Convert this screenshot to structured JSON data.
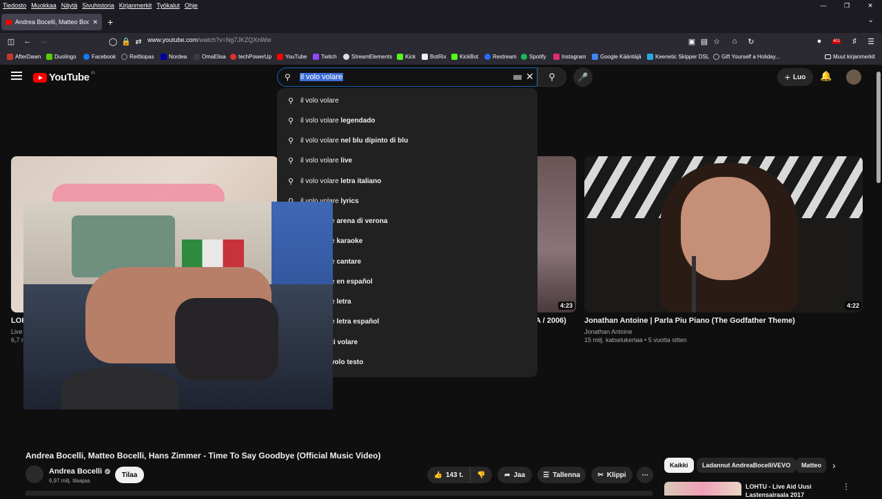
{
  "menu": [
    "Tiedosto",
    "Muokkaa",
    "Näytä",
    "Sivuhistoria",
    "Kirjanmerkit",
    "Työkalut",
    "Ohje"
  ],
  "tab": {
    "title": "Andrea Bocelli, Matteo Bocelli, H"
  },
  "address": {
    "host": "www.youtube.com",
    "path": "/watch?v=Ng7JKZQXnWw"
  },
  "extension_badge": "401",
  "bookmarks": [
    {
      "label": "AfterDawn",
      "color": "#c0392b"
    },
    {
      "label": "Duolingo",
      "color": "#58cc02"
    },
    {
      "label": "Facebook",
      "color": "#1877f2"
    },
    {
      "label": "Reittiopas",
      "color": "#9a9a9a"
    },
    {
      "label": "Nordea",
      "color": "#0000a0"
    },
    {
      "label": "OmaElisa",
      "color": "#2b2a33"
    },
    {
      "label": "techPowerUp",
      "color": "#e03030"
    },
    {
      "label": "YouTube",
      "color": "#ff0000"
    },
    {
      "label": "Twitch",
      "color": "#9146ff"
    },
    {
      "label": "StreamElements",
      "color": "#dddddd"
    },
    {
      "label": "Kick",
      "color": "#53fc18"
    },
    {
      "label": "BotRix",
      "color": "#eeeeee"
    },
    {
      "label": "KickBot",
      "color": "#53fc18"
    },
    {
      "label": "Restream",
      "color": "#2b6bff"
    },
    {
      "label": "Spotify",
      "color": "#1db954"
    },
    {
      "label": "Instagram",
      "color": "#e1306c"
    },
    {
      "label": "Google Kääntäjä",
      "color": "#4285f4"
    },
    {
      "label": "Keenetic Skipper DSL",
      "color": "#2aa8e0"
    },
    {
      "label": "Gift Yourself a Holiday...",
      "color": "#bbbbbb"
    }
  ],
  "other_bookmarks": "Muut kirjanmerkit",
  "youtube": {
    "region": "FI",
    "search_value": "il volo volare",
    "create_label": "Luo",
    "suggestions": [
      {
        "base": "il volo volare",
        "extra": ""
      },
      {
        "base": "il volo volare ",
        "extra": "legendado"
      },
      {
        "base": "il volo volare ",
        "extra": "nel blu dipinto di blu"
      },
      {
        "base": "il volo volare ",
        "extra": "live"
      },
      {
        "base": "il volo volare ",
        "extra": "letra italiano"
      },
      {
        "base": "il volo volare ",
        "extra": "lyrics"
      },
      {
        "base": "lare ",
        "extra": "arena di verona"
      },
      {
        "base": "lare ",
        "extra": "karaoke"
      },
      {
        "base": "lare ",
        "extra": "cantare"
      },
      {
        "base": "lare ",
        "extra": "en español"
      },
      {
        "base": "lare ",
        "extra": "letra"
      },
      {
        "base": "lare ",
        "extra": "letra español"
      },
      {
        "base": "r ti volare",
        "extra": ""
      },
      {
        "base": "volo testo",
        "extra": ""
      }
    ],
    "cards": [
      {
        "title": "LOH",
        "channel": "Live",
        "meta": "6,7 m"
      },
      {
        "title": "A / 2006)",
        "duration": "4:23"
      },
      {
        "title": "Jonathan Antoine | Parla Piu Piano (The Godfather Theme)",
        "channel": "Jonathan Antoine",
        "meta": "15 milj. katselukertaa • 5 vuotta sitten",
        "duration": "4:22"
      }
    ],
    "video": {
      "title": "Andrea Bocelli, Matteo Bocelli, Hans Zimmer - Time To Say Goodbye (Official Music Video)",
      "channel": "Andrea Bocelli",
      "subscribers": "6,97 milj. tilaajaa",
      "subscribe": "Tilaa",
      "likes": "143 t.",
      "share": "Jaa",
      "save": "Tallenna",
      "clip": "Klippi"
    },
    "chips": [
      "Kaikki",
      "Ladannut AndreaBocelliVEVO",
      "Matteo"
    ],
    "side_title": "LOHTU - Live Aid Uusi Lastensairaala 2017"
  }
}
